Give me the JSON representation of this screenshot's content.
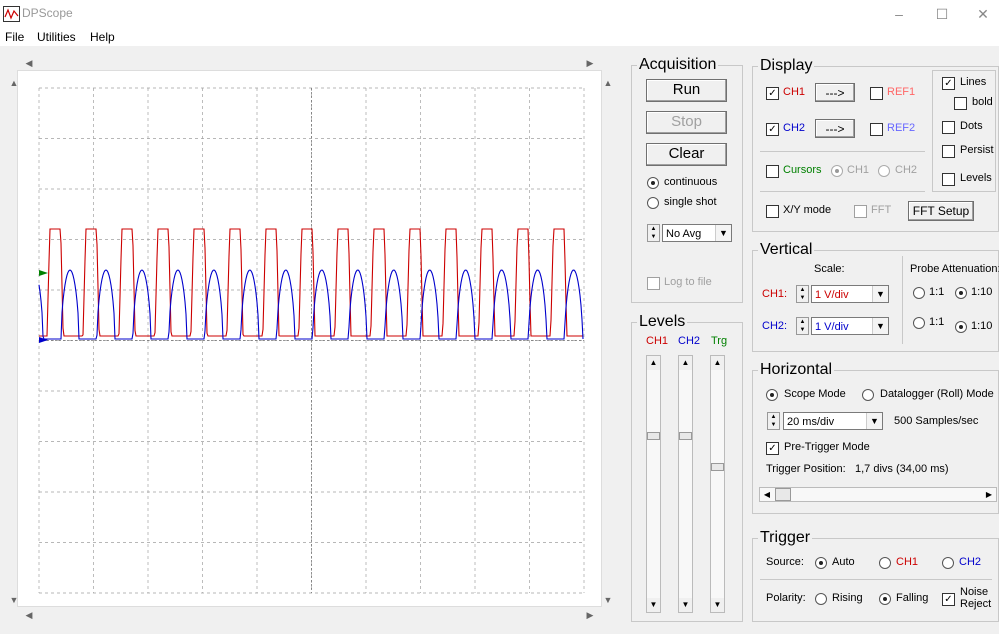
{
  "window": {
    "title": "DPScope"
  },
  "menu": {
    "file": "File",
    "utilities": "Utilities",
    "help": "Help"
  },
  "acquisition": {
    "title": "Acquisition",
    "run": "Run",
    "stop": "Stop",
    "clear": "Clear",
    "continuous": "continuous",
    "single_shot": "single shot",
    "avg": "No Avg",
    "log": "Log to file"
  },
  "display": {
    "title": "Display",
    "ch1": "CH1",
    "ch2": "CH2",
    "arrow": "--->",
    "ref1": "REF1",
    "ref2": "REF2",
    "lines": "Lines",
    "bold": "bold",
    "dots": "Dots",
    "persist": "Persist",
    "levels": "Levels",
    "cursors": "Cursors",
    "cur_ch1": "CH1",
    "cur_ch2": "CH2",
    "xy": "X/Y mode",
    "fft": "FFT",
    "fft_setup": "FFT Setup"
  },
  "vertical": {
    "title": "Vertical",
    "scale": "Scale:",
    "probe": "Probe Attenuation:",
    "ch1_label": "CH1:",
    "ch2_label": "CH2:",
    "ch1_scale": "1 V/div",
    "ch2_scale": "1 V/div",
    "att_1": "1:1",
    "att_10": "1:10"
  },
  "levels": {
    "title": "Levels",
    "ch1": "CH1",
    "ch2": "CH2",
    "trg": "Trg",
    "ch1_value": 0.28,
    "ch2_value": 0.28,
    "trg_value": 0.42
  },
  "horizontal": {
    "title": "Horizontal",
    "scope_mode": "Scope Mode",
    "datalogger": "Datalogger (Roll) Mode",
    "timebase": "20 ms/div",
    "rate": "500 Samples/sec",
    "pretrigger": "Pre-Trigger Mode",
    "trigger_pos_label": "Trigger Position:",
    "trigger_pos_value": "1,7 divs (34,00 ms)"
  },
  "trigger": {
    "title": "Trigger",
    "source": "Source:",
    "auto": "Auto",
    "ch1": "CH1",
    "ch2": "CH2",
    "polarity": "Polarity:",
    "rising": "Rising",
    "falling": "Falling",
    "noise1": "Noise",
    "noise2": "Reject"
  },
  "colors": {
    "ch1": "#cc0000",
    "ch2": "#0000cc",
    "trg": "#008000",
    "grid": "#a0a0a0"
  },
  "waveform": {
    "ch1_period_ms": 13.2,
    "ch2_period_ms": 13.2,
    "time_per_div_ms": 20,
    "volts_per_div": 1
  }
}
